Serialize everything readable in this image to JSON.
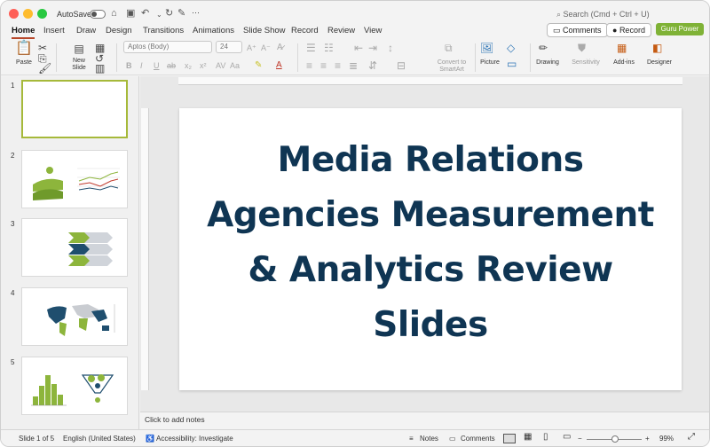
{
  "titlebar": {
    "autosave_label": "AutoSave",
    "search_placeholder": "Search (Cmd + Ctrl + U)",
    "more": "···"
  },
  "tabs": [
    "Home",
    "Insert",
    "Draw",
    "Design",
    "Transitions",
    "Animations",
    "Slide Show",
    "Record",
    "Review",
    "View"
  ],
  "active_tab": "Home",
  "tab_actions": {
    "comments": "Comments",
    "record": "Record",
    "guru": "Guru Power"
  },
  "ribbon": {
    "paste": "Paste",
    "new_slide": "New\nSlide",
    "font_name": "Aptos (Body)",
    "font_size": "24",
    "convert_smartart": "Convert to\nSmartArt",
    "picture": "Picture",
    "drawing": "Drawing",
    "sensitivity": "Sensitivity",
    "addins": "Add-ins",
    "designer": "Designer"
  },
  "slides": [
    {
      "num": "1",
      "selected": true
    },
    {
      "num": "2",
      "selected": false
    },
    {
      "num": "3",
      "selected": false
    },
    {
      "num": "4",
      "selected": false
    },
    {
      "num": "5",
      "selected": false
    }
  ],
  "slide": {
    "title_lines": [
      "Media Relations",
      "Agencies Measurement",
      "& Analytics Review",
      "Slides"
    ]
  },
  "notes_placeholder": "Click to add notes",
  "status": {
    "slide_of": "Slide 1 of 5",
    "language": "English (United States)",
    "accessibility": "Accessibility: Investigate",
    "notes": "Notes",
    "comments": "Comments",
    "zoom": "99%"
  },
  "colors": {
    "accent": "#b7472a",
    "title_text": "#0f3553",
    "lime": "#8db53c",
    "navy": "#1f4e6e",
    "guru_button": "#7fb236"
  },
  "icons": [
    "home-icon",
    "save-icon",
    "undo-icon",
    "redo-icon",
    "search-icon",
    "comment-icon",
    "record-icon"
  ]
}
